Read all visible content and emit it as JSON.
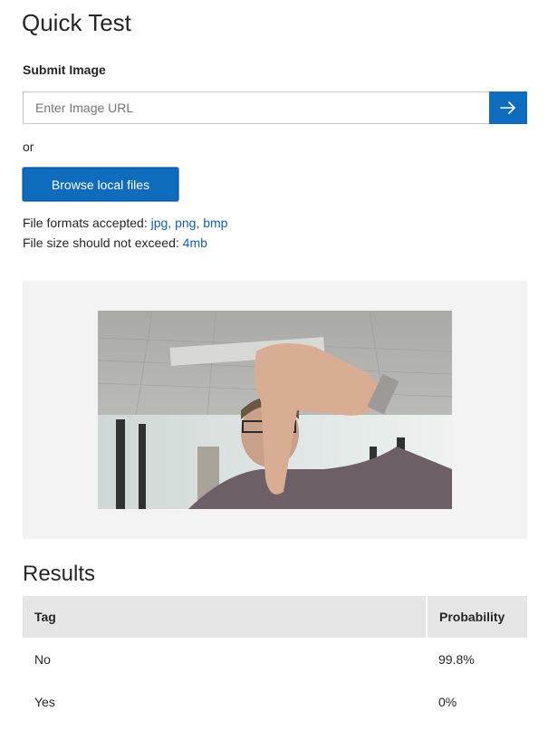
{
  "page": {
    "title": "Quick Test"
  },
  "submit": {
    "label": "Submit Image",
    "url_placeholder": "Enter Image URL",
    "url_value": "",
    "or_text": "or",
    "browse_label": "Browse local files"
  },
  "formats": {
    "formats_label": "File formats accepted: ",
    "formats_value": "jpg, png, bmp",
    "size_label": "File size should not exceed: ",
    "size_value": "4mb"
  },
  "results": {
    "title": "Results",
    "columns": {
      "tag": "Tag",
      "probability": "Probability"
    },
    "rows": [
      {
        "tag": "No",
        "probability": "99.8%"
      },
      {
        "tag": "Yes",
        "probability": "0%"
      }
    ]
  },
  "colors": {
    "accent": "#0f6cbd",
    "link": "#1a5eab",
    "panel": "#f3f3f3",
    "table_header": "#e6e6e6"
  },
  "icons": {
    "submit": "arrow-right-icon"
  }
}
